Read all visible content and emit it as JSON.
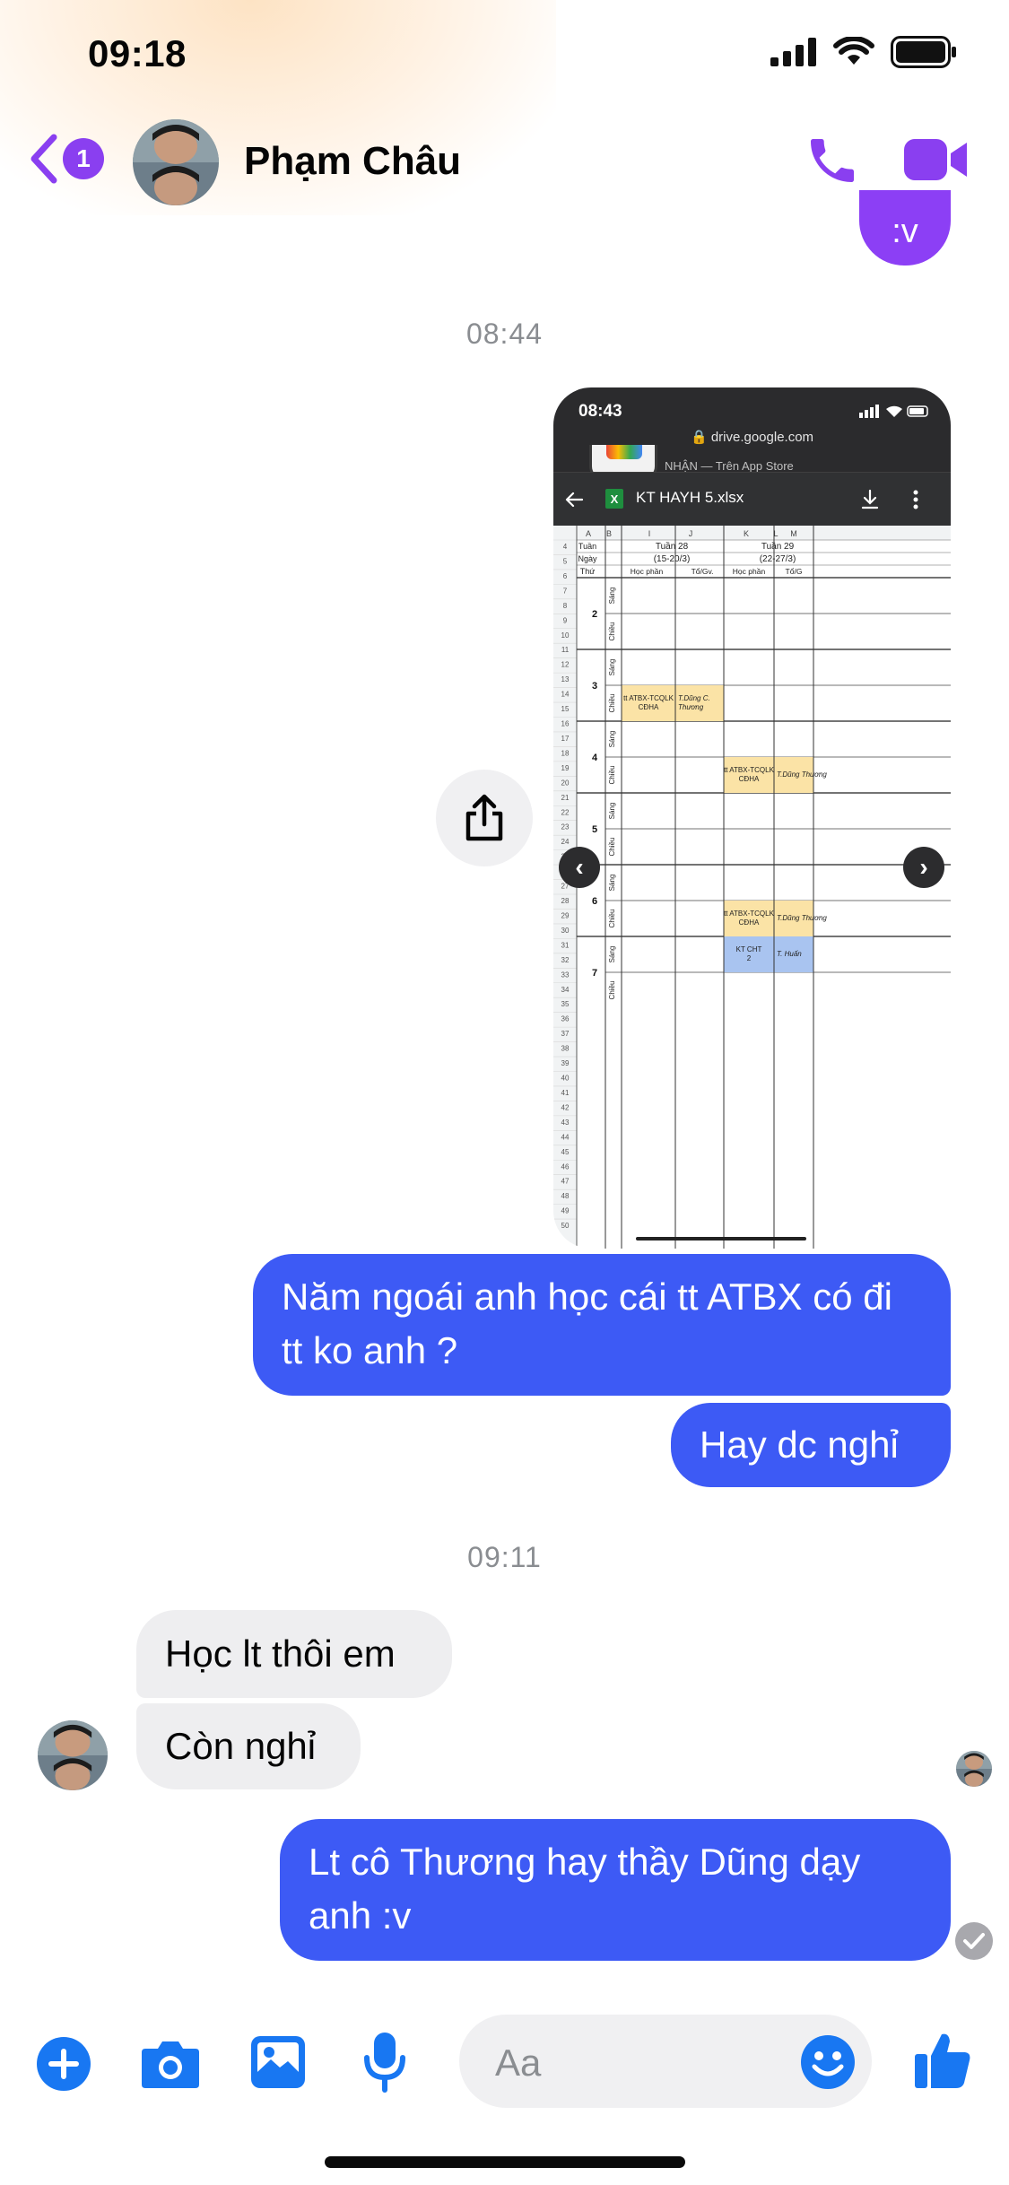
{
  "status_bar": {
    "time": "09:18"
  },
  "header": {
    "back_badge": "1",
    "contact_name": "Phạm Châu"
  },
  "stub_bubble": ":v",
  "timestamps": {
    "first": "08:44",
    "second": "09:11"
  },
  "shared_photo": {
    "status_time": "08:43",
    "url": "drive.google.com",
    "store_banner": "NHẬN — Trên App Store",
    "file_name": "KT HAYH 5.xlsx",
    "file_icon": "X",
    "columns": [
      "A",
      "B",
      "I",
      "J",
      "K",
      "L",
      "M"
    ],
    "row_labels": {
      "tuan": "Tuần",
      "ngay": "Ngày",
      "thu": "Thứ"
    },
    "weeks": [
      {
        "name": "Tuần 28",
        "dates": "(15-20/3)"
      },
      {
        "name": "Tuần 29",
        "dates": "(22-27/3)"
      }
    ],
    "subheaders": [
      "Học phần",
      "Tổ/Gv.",
      "Học phần",
      "Tổ/G"
    ],
    "days": [
      "2",
      "3",
      "4",
      "5",
      "6",
      "7"
    ],
    "sessions": {
      "morning": "Sáng",
      "afternoon": "Chiều"
    },
    "cells": [
      {
        "course": "tt ATBX-TCQLK CĐHA",
        "teacher": "T.Dũng C. Thương"
      },
      {
        "course": "tt ATBX-TCQLK CĐHA",
        "teacher": "T.Dũng Thương"
      },
      {
        "course": "tt ATBX-TCQLK CĐHA",
        "teacher": "T.Dũng Thương"
      },
      {
        "course": "KT CHT 2",
        "teacher": "T. Huấn"
      }
    ],
    "colors": {
      "yellow": "#fbe3a6",
      "blue": "#a9c4f0"
    }
  },
  "messages": [
    {
      "id": "m1",
      "dir": "out",
      "text": "Năm ngoái anh học cái tt ATBX có đi tt ko anh ?"
    },
    {
      "id": "m2",
      "dir": "out",
      "text": "Hay dc nghỉ"
    },
    {
      "id": "m3",
      "dir": "in",
      "text": "Học lt thôi em"
    },
    {
      "id": "m4",
      "dir": "in",
      "text": "Còn nghỉ"
    },
    {
      "id": "m5",
      "dir": "out",
      "text": "Lt cô Thương hay thầy Dũng dạy anh :v"
    }
  ],
  "composer": {
    "placeholder": "Aa",
    "icons": [
      "plus-icon",
      "camera-icon",
      "gallery-icon",
      "microphone-icon",
      "emoji-icon",
      "thumbs-up-icon"
    ]
  },
  "colors": {
    "accent": "#8c3ff5",
    "outgoing_bubble": "#3d5af5",
    "incoming_bubble": "#eeeef0",
    "composer_icon": "#1877f2",
    "timestamp": "#8a8d91"
  }
}
